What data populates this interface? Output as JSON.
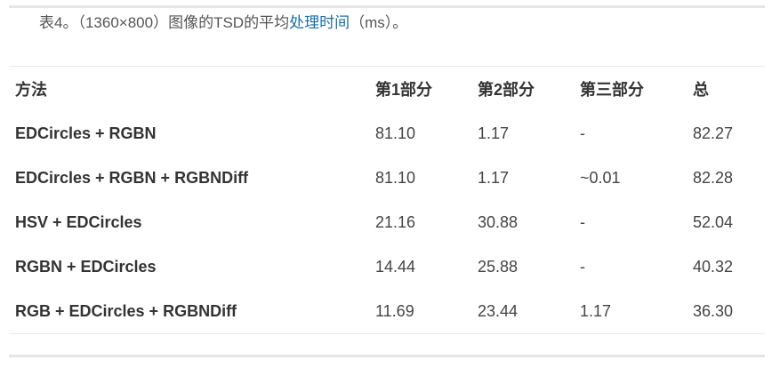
{
  "caption": {
    "prefix": "表4。（1360×800）图像的TSD的平均",
    "link_text": "处理时间",
    "suffix": "（ms）。"
  },
  "table": {
    "headers": [
      "方法",
      "第1部分",
      "第2部分",
      "第三部分",
      "总"
    ],
    "rows": [
      [
        "EDCircles + RGBN",
        "81.10",
        "1.17",
        "-",
        "82.27"
      ],
      [
        "EDCircles + RGBN + RGBNDiff",
        "81.10",
        "1.17",
        "~0.01",
        "82.28"
      ],
      [
        "HSV + EDCircles",
        "21.16",
        "30.88",
        "-",
        "52.04"
      ],
      [
        "RGBN + EDCircles",
        "14.44",
        "25.88",
        "-",
        "40.32"
      ],
      [
        "RGB + EDCircles + RGBNDiff",
        "11.69",
        "23.44",
        "1.17",
        "36.30"
      ]
    ]
  }
}
